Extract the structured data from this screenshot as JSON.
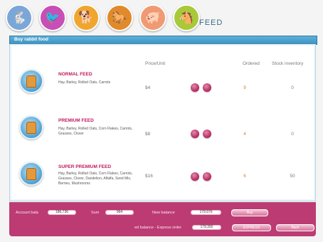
{
  "tabs": [
    {
      "icon": "rabbit-icon",
      "glyph": "🐇",
      "color": "#7aa7d8"
    },
    {
      "icon": "bird-icon",
      "glyph": "🐦",
      "color": "#c74fb5"
    },
    {
      "icon": "dog-icon",
      "glyph": "🐕",
      "color": "#f0a62e"
    },
    {
      "icon": "horse-icon",
      "glyph": "🐎",
      "color": "#e08a2b"
    },
    {
      "icon": "pig-icon",
      "glyph": "🐖",
      "color": "#f09a74"
    },
    {
      "icon": "pony-icon",
      "glyph": "🐴",
      "color": "#a8c93a"
    }
  ],
  "page_title": "FEED",
  "section_title": "Buy rabbit food",
  "columns": {
    "price": "Price/Unit",
    "ordered": "Ordered",
    "stock": "Stock inventory"
  },
  "feeds": [
    {
      "name": "NORMAL FEED",
      "description": "Hay, Barley, Rolled Oats, Carrots",
      "price": "$4",
      "ordered": "9",
      "stock": "0"
    },
    {
      "name": "PREMIUM FEED",
      "description": "Hay, Barley, Rolled Oats, Corn Flakes, Carrots, Grasses, Clover",
      "price": "$8",
      "ordered": "4",
      "stock": "0"
    },
    {
      "name": "SUPER PREMIUM FEED",
      "description": "Hay, Barley, Rolled Oats, Corn Flakes, Carrots, Grasses, Clover, Dandelion, Alfalfa, Seed Mix, Berries, Mushrooms",
      "price": "$16",
      "ordered": "6",
      "stock": "50"
    }
  ],
  "footer": {
    "account_label": "Account bala",
    "account_value": "186,736",
    "sum_label": "Sum",
    "sum_value": "964",
    "new_balance_label": "New balance",
    "new_balance_value": "179,976",
    "buy_label": "Buy",
    "expected_label": "ed balance - Express order",
    "expected_value": "179,392",
    "express_label": "EXPRESS",
    "back_label": "Back"
  },
  "colors": {
    "accent": "#bc3b73",
    "header": "#3d8fbd",
    "ordered": "#e07a2c"
  }
}
